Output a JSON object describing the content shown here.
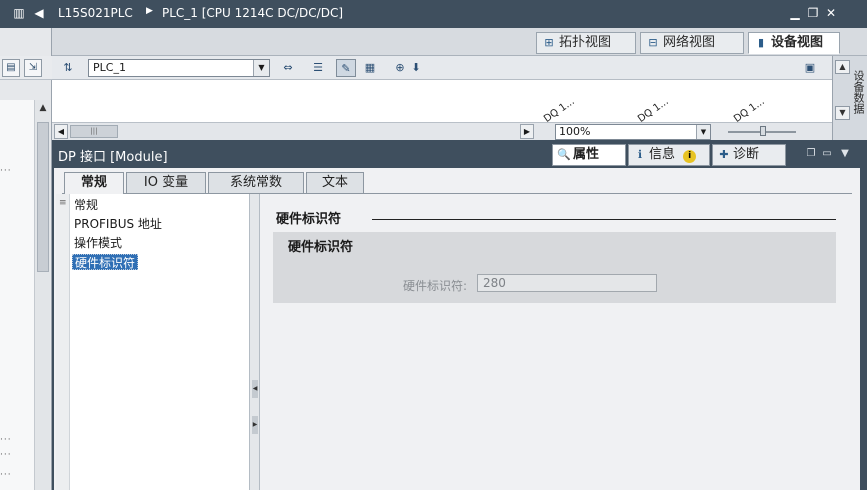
{
  "window": {
    "breadcrumb": [
      "L15S021PLC",
      "PLC_1 [CPU 1214C DC/DC/DC]"
    ],
    "controls": [
      "minimize",
      "restore",
      "close"
    ]
  },
  "view_tabs": [
    {
      "label": "拓扑视图",
      "icon": "topology-icon",
      "active": false
    },
    {
      "label": "网络视图",
      "icon": "network-icon",
      "active": false
    },
    {
      "label": "设备视图",
      "icon": "device-icon",
      "active": true
    }
  ],
  "device_toolbar": {
    "device_selected": "PLC_1",
    "zoom_value": "100%"
  },
  "canvas": {
    "slot_labels": [
      "DQ 1...",
      "DQ 1...",
      "DQ 1..."
    ]
  },
  "right_panel": {
    "label": "设备数据"
  },
  "inspector": {
    "title": "DP 接口 [Module]",
    "tabs": [
      {
        "label": "属性",
        "icon": "properties-icon",
        "active": true
      },
      {
        "label": "信息",
        "icon": "info-icon",
        "active": false
      },
      {
        "label": "诊断",
        "icon": "diagnostics-icon",
        "active": false
      }
    ],
    "subtabs": [
      "常规",
      "IO 变量",
      "系统常数",
      "文本"
    ],
    "active_subtab": "常规",
    "nav": [
      "常规",
      "PROFIBUS 地址",
      "操作模式",
      "硬件标识符"
    ],
    "selected_nav": "硬件标识符",
    "section_heading": "硬件标识符",
    "group_title": "硬件标识符",
    "field_label": "硬件标识符:",
    "field_value": "280"
  }
}
